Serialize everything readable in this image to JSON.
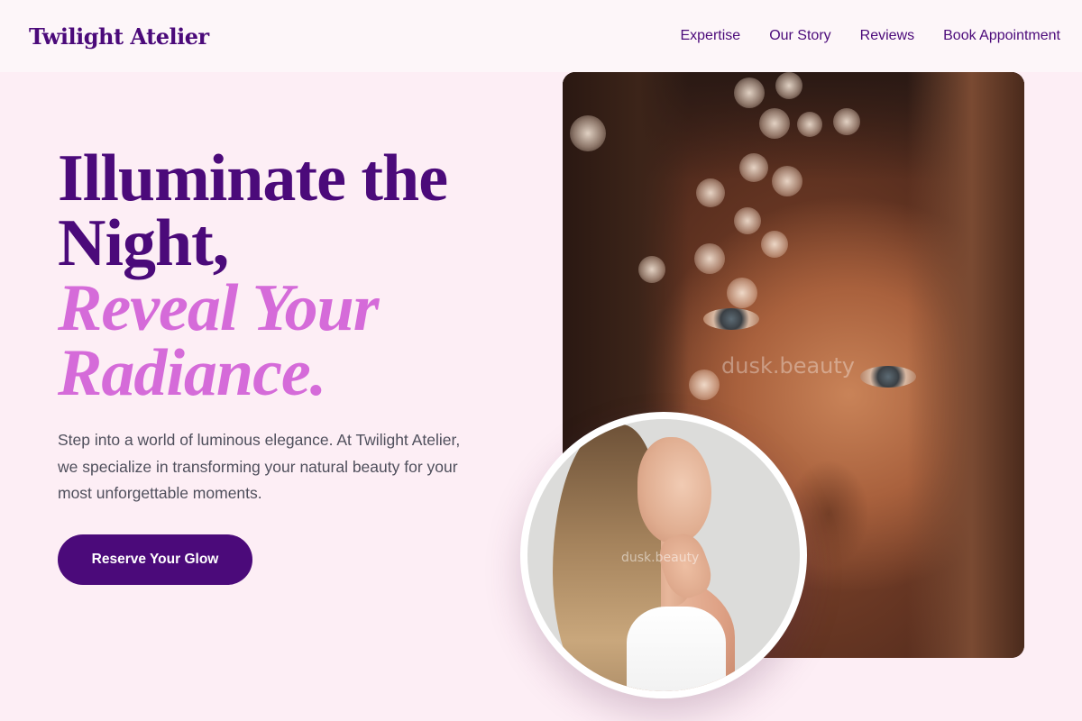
{
  "header": {
    "brand": "Twilight Atelier",
    "nav": [
      "Expertise",
      "Our Story",
      "Reviews",
      "Book Appointment"
    ]
  },
  "hero": {
    "title_line1": "Illuminate the",
    "title_line2": "Night,",
    "title_accent_line1": "Reveal Your",
    "title_accent_line2": "Radiance.",
    "description": "Step into a world of luminous elegance. At Twilight Atelier, we specialize in transforming your natural beauty for your most unforgettable moments.",
    "cta_label": "Reserve Your Glow"
  },
  "images": {
    "main_watermark": "dusk.beauty",
    "circle_watermark": "dusk.beauty"
  },
  "colors": {
    "brand": "#4b0a7a",
    "accent": "#d56bd9",
    "background": "#fdeef5"
  }
}
